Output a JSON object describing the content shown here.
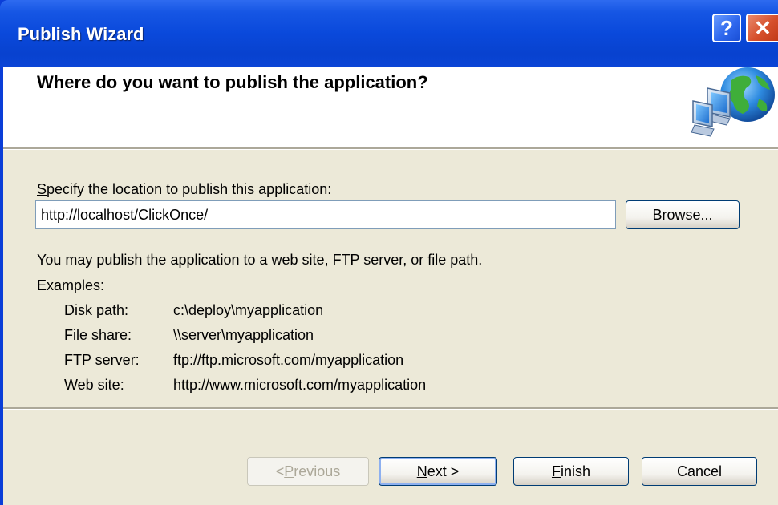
{
  "window": {
    "title": "Publish Wizard",
    "help_glyph": "?",
    "close_glyph": "✕"
  },
  "header": {
    "heading": "Where do you want to publish the application?",
    "icon": "network-globe-icon"
  },
  "location": {
    "label_first": "S",
    "label_rest": "pecify the location to publish this application:",
    "value": "http://localhost/ClickOnce/",
    "browse_label": "Browse..."
  },
  "info": {
    "description": "You may publish the application to a web site, FTP server, or file path.",
    "examples_heading": "Examples:",
    "examples": [
      {
        "kind": "Disk path:",
        "value": "c:\\deploy\\myapplication"
      },
      {
        "kind": "File share:",
        "value": "\\\\server\\myapplication"
      },
      {
        "kind": "FTP server:",
        "value": "ftp://ftp.microsoft.com/myapplication"
      },
      {
        "kind": "Web site:",
        "value": "http://www.microsoft.com/myapplication"
      }
    ]
  },
  "buttons": {
    "previous_prefix": "< ",
    "previous_hot": "P",
    "previous_rest": "revious",
    "next_hot": "N",
    "next_rest": "ext >",
    "finish_hot": "F",
    "finish_rest": "inish",
    "cancel": "Cancel"
  }
}
